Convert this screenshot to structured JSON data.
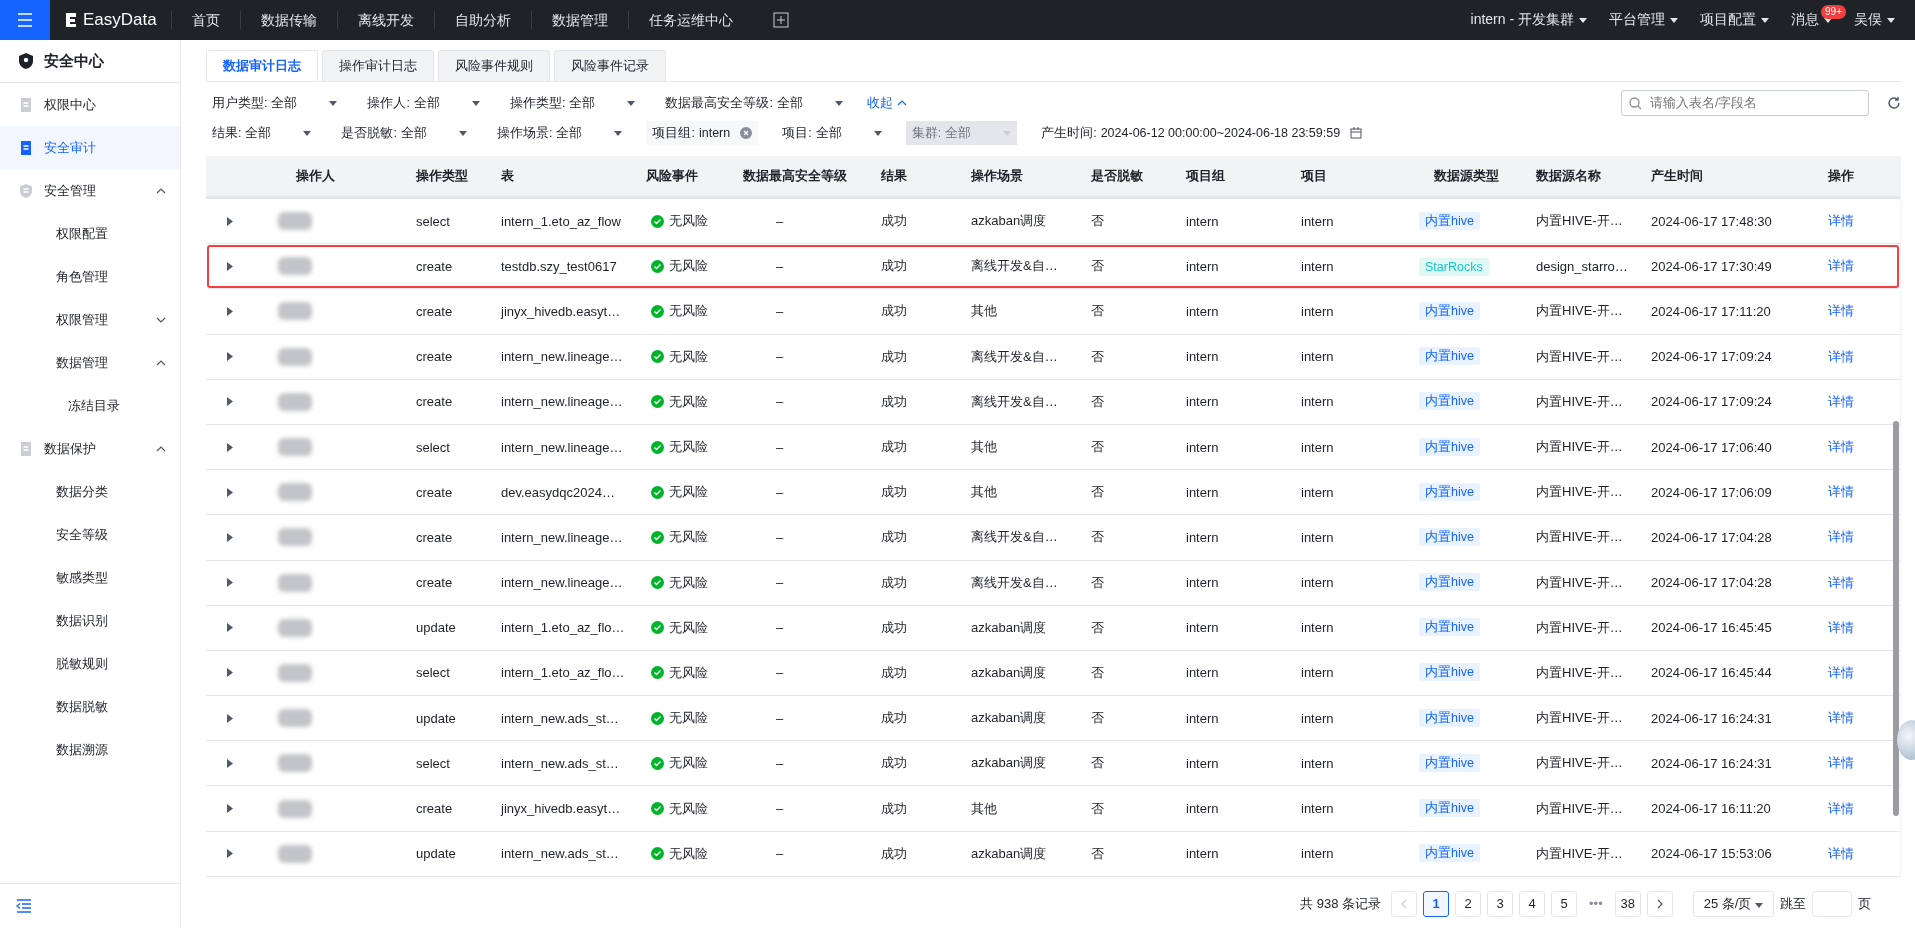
{
  "topbar": {
    "logo": "EasyData",
    "nav": [
      {
        "label": "首页",
        "selected": false
      },
      {
        "label": "数据传输",
        "selected": false
      },
      {
        "label": "离线开发",
        "selected": false
      },
      {
        "label": "自助分析",
        "selected": false
      },
      {
        "label": "数据管理",
        "selected": false
      },
      {
        "label": "任务运维中心",
        "selected": false
      }
    ],
    "right": [
      {
        "label": "intern - 开发集群"
      },
      {
        "label": "平台管理"
      },
      {
        "label": "项目配置"
      },
      {
        "label": "消息",
        "badge": "99+"
      },
      {
        "label": "吴俣"
      }
    ]
  },
  "sidebar": {
    "title": "安全中心",
    "items": [
      {
        "label": "权限中心",
        "selected": false
      },
      {
        "label": "安全审计",
        "selected": true
      },
      {
        "label": "安全管理",
        "expanded": true,
        "selected": false,
        "children": [
          {
            "label": "权限配置",
            "selected": false
          },
          {
            "label": "角色管理",
            "selected": false
          },
          {
            "label": "权限管理",
            "expanded": false,
            "selected": false
          },
          {
            "label": "数据管理",
            "expanded": true,
            "selected": false,
            "children": [
              {
                "label": "冻结目录",
                "selected": false
              }
            ]
          }
        ]
      },
      {
        "label": "数据保护",
        "expanded": true,
        "selected": false,
        "children": [
          {
            "label": "数据分类",
            "selected": false
          },
          {
            "label": "安全等级",
            "selected": false
          },
          {
            "label": "敏感类型",
            "selected": false
          },
          {
            "label": "数据识别",
            "selected": false
          },
          {
            "label": "脱敏规则",
            "selected": false
          },
          {
            "label": "数据脱敏",
            "selected": false
          },
          {
            "label": "数据溯源",
            "selected": false
          }
        ]
      }
    ]
  },
  "tabs": [
    {
      "label": "数据审计日志",
      "selected": true
    },
    {
      "label": "操作审计日志",
      "selected": false
    },
    {
      "label": "风险事件规则",
      "selected": false
    },
    {
      "label": "风险事件记录",
      "selected": false
    }
  ],
  "filters": [
    [
      {
        "label": "用户类型:",
        "value": "全部",
        "kind": "select",
        "disabled": false
      },
      {
        "label": "操作人:",
        "value": "全部",
        "kind": "select",
        "disabled": false
      },
      {
        "label": "操作类型:",
        "value": "全部",
        "kind": "select",
        "disabled": false
      },
      {
        "label": "数据最高安全等级:",
        "value": "全部",
        "kind": "select",
        "disabled": false
      }
    ],
    [
      {
        "label": "结果:",
        "value": "全部",
        "kind": "select",
        "disabled": false
      },
      {
        "label": "是否脱敏:",
        "value": "全部",
        "kind": "select",
        "disabled": false
      },
      {
        "label": "操作场景:",
        "value": "全部",
        "kind": "select",
        "disabled": false
      },
      {
        "label": "项目组:",
        "value": "intern",
        "kind": "clearable",
        "disabled": false
      },
      {
        "label": "项目:",
        "value": "全部",
        "kind": "select",
        "disabled": false
      },
      {
        "label": "集群:",
        "value": "全部",
        "kind": "select",
        "disabled": true
      },
      {
        "label": "产生时间:",
        "value": "2024-06-12 00:00:00~2024-06-18 23:59:59",
        "kind": "date",
        "disabled": false
      }
    ]
  ],
  "collapse_link": "收起",
  "search": {
    "placeholder": "请输入表名/字段名"
  },
  "table": {
    "columns": [
      "操作人",
      "操作类型",
      "表",
      "风险事件",
      "数据最高安全等级",
      "结果",
      "操作场景",
      "是否脱敏",
      "项目组",
      "项目",
      "数据源类型",
      "数据源名称",
      "产生时间",
      "操作"
    ],
    "rows": [
      {
        "expanded": false,
        "highlighted": false,
        "type": "select",
        "table": "intern_1.eto_az_flow",
        "risk": "无风险",
        "level": "–",
        "result": "成功",
        "scene": "azkaban调度",
        "masked": "否",
        "group": "intern",
        "project": "intern",
        "ds_type": {
          "text": "内置hive",
          "kind": "hive"
        },
        "ds_name": "内置HIVE-开…",
        "time": "2024-06-17 17:48:30",
        "action": "详情"
      },
      {
        "expanded": false,
        "highlighted": true,
        "type": "create",
        "table": "testdb.szy_test0617",
        "risk": "无风险",
        "level": "–",
        "result": "成功",
        "scene": "离线开发&自…",
        "masked": "否",
        "group": "intern",
        "project": "intern",
        "ds_type": {
          "text": "StarRocks",
          "kind": "starrocks"
        },
        "ds_name": "design_starro…",
        "time": "2024-06-17 17:30:49",
        "action": "详情"
      },
      {
        "expanded": false,
        "highlighted": false,
        "type": "create",
        "table": "jinyx_hivedb.easyt…",
        "risk": "无风险",
        "level": "–",
        "result": "成功",
        "scene": "其他",
        "masked": "否",
        "group": "intern",
        "project": "intern",
        "ds_type": {
          "text": "内置hive",
          "kind": "hive"
        },
        "ds_name": "内置HIVE-开…",
        "time": "2024-06-17 17:11:20",
        "action": "详情"
      },
      {
        "expanded": false,
        "highlighted": false,
        "type": "create",
        "table": "intern_new.lineage…",
        "risk": "无风险",
        "level": "–",
        "result": "成功",
        "scene": "离线开发&自…",
        "masked": "否",
        "group": "intern",
        "project": "intern",
        "ds_type": {
          "text": "内置hive",
          "kind": "hive"
        },
        "ds_name": "内置HIVE-开…",
        "time": "2024-06-17 17:09:24",
        "action": "详情"
      },
      {
        "expanded": false,
        "highlighted": false,
        "type": "create",
        "table": "intern_new.lineage…",
        "risk": "无风险",
        "level": "–",
        "result": "成功",
        "scene": "离线开发&自…",
        "masked": "否",
        "group": "intern",
        "project": "intern",
        "ds_type": {
          "text": "内置hive",
          "kind": "hive"
        },
        "ds_name": "内置HIVE-开…",
        "time": "2024-06-17 17:09:24",
        "action": "详情"
      },
      {
        "expanded": false,
        "highlighted": false,
        "type": "select",
        "table": "intern_new.lineage…",
        "risk": "无风险",
        "level": "–",
        "result": "成功",
        "scene": "其他",
        "masked": "否",
        "group": "intern",
        "project": "intern",
        "ds_type": {
          "text": "内置hive",
          "kind": "hive"
        },
        "ds_name": "内置HIVE-开…",
        "time": "2024-06-17 17:06:40",
        "action": "详情"
      },
      {
        "expanded": false,
        "highlighted": false,
        "type": "create",
        "table": "dev.easydqc2024…",
        "risk": "无风险",
        "level": "–",
        "result": "成功",
        "scene": "其他",
        "masked": "否",
        "group": "intern",
        "project": "intern",
        "ds_type": {
          "text": "内置hive",
          "kind": "hive"
        },
        "ds_name": "内置HIVE-开…",
        "time": "2024-06-17 17:06:09",
        "action": "详情"
      },
      {
        "expanded": false,
        "highlighted": false,
        "type": "create",
        "table": "intern_new.lineage…",
        "risk": "无风险",
        "level": "–",
        "result": "成功",
        "scene": "离线开发&自…",
        "masked": "否",
        "group": "intern",
        "project": "intern",
        "ds_type": {
          "text": "内置hive",
          "kind": "hive"
        },
        "ds_name": "内置HIVE-开…",
        "time": "2024-06-17 17:04:28",
        "action": "详情"
      },
      {
        "expanded": false,
        "highlighted": false,
        "type": "create",
        "table": "intern_new.lineage…",
        "risk": "无风险",
        "level": "–",
        "result": "成功",
        "scene": "离线开发&自…",
        "masked": "否",
        "group": "intern",
        "project": "intern",
        "ds_type": {
          "text": "内置hive",
          "kind": "hive"
        },
        "ds_name": "内置HIVE-开…",
        "time": "2024-06-17 17:04:28",
        "action": "详情"
      },
      {
        "expanded": false,
        "highlighted": false,
        "type": "update",
        "table": "intern_1.eto_az_flo…",
        "risk": "无风险",
        "level": "–",
        "result": "成功",
        "scene": "azkaban调度",
        "masked": "否",
        "group": "intern",
        "project": "intern",
        "ds_type": {
          "text": "内置hive",
          "kind": "hive"
        },
        "ds_name": "内置HIVE-开…",
        "time": "2024-06-17 16:45:45",
        "action": "详情"
      },
      {
        "expanded": false,
        "highlighted": false,
        "type": "select",
        "table": "intern_1.eto_az_flo…",
        "risk": "无风险",
        "level": "–",
        "result": "成功",
        "scene": "azkaban调度",
        "masked": "否",
        "group": "intern",
        "project": "intern",
        "ds_type": {
          "text": "内置hive",
          "kind": "hive"
        },
        "ds_name": "内置HIVE-开…",
        "time": "2024-06-17 16:45:44",
        "action": "详情"
      },
      {
        "expanded": false,
        "highlighted": false,
        "type": "update",
        "table": "intern_new.ads_st…",
        "risk": "无风险",
        "level": "–",
        "result": "成功",
        "scene": "azkaban调度",
        "masked": "否",
        "group": "intern",
        "project": "intern",
        "ds_type": {
          "text": "内置hive",
          "kind": "hive"
        },
        "ds_name": "内置HIVE-开…",
        "time": "2024-06-17 16:24:31",
        "action": "详情"
      },
      {
        "expanded": false,
        "highlighted": false,
        "type": "select",
        "table": "intern_new.ads_st…",
        "risk": "无风险",
        "level": "–",
        "result": "成功",
        "scene": "azkaban调度",
        "masked": "否",
        "group": "intern",
        "project": "intern",
        "ds_type": {
          "text": "内置hive",
          "kind": "hive"
        },
        "ds_name": "内置HIVE-开…",
        "time": "2024-06-17 16:24:31",
        "action": "详情"
      },
      {
        "expanded": false,
        "highlighted": false,
        "type": "create",
        "table": "jinyx_hivedb.easyt…",
        "risk": "无风险",
        "level": "–",
        "result": "成功",
        "scene": "其他",
        "masked": "否",
        "group": "intern",
        "project": "intern",
        "ds_type": {
          "text": "内置hive",
          "kind": "hive"
        },
        "ds_name": "内置HIVE-开…",
        "time": "2024-06-17 16:11:20",
        "action": "详情"
      },
      {
        "expanded": false,
        "highlighted": false,
        "type": "update",
        "table": "intern_new.ads_st…",
        "risk": "无风险",
        "level": "–",
        "result": "成功",
        "scene": "azkaban调度",
        "masked": "否",
        "group": "intern",
        "project": "intern",
        "ds_type": {
          "text": "内置hive",
          "kind": "hive"
        },
        "ds_name": "内置HIVE-开…",
        "time": "2024-06-17 15:53:06",
        "action": "详情"
      }
    ]
  },
  "pagination": {
    "total": "共 938 条记录",
    "pages": [
      {
        "label": "1",
        "selected": true
      },
      {
        "label": "2",
        "selected": false
      },
      {
        "label": "3",
        "selected": false
      },
      {
        "label": "4",
        "selected": false
      },
      {
        "label": "5",
        "selected": false
      },
      {
        "label": "•••",
        "kind": "ellipsis"
      },
      {
        "label": "38",
        "selected": false
      }
    ],
    "page_size": "25 条/页",
    "jump_label": "跳至",
    "jump_unit": "页"
  }
}
